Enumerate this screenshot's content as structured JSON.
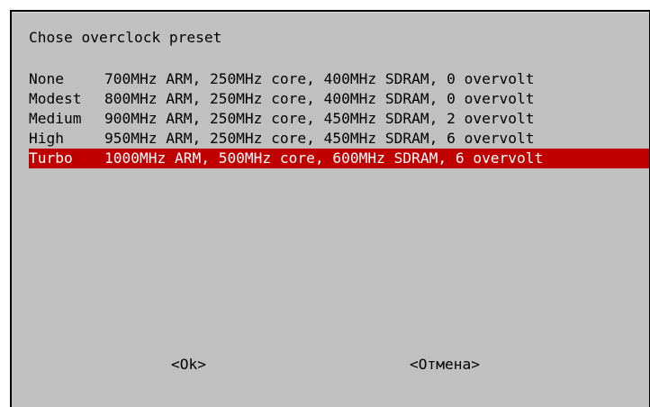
{
  "dialog": {
    "title": "Chose overclock preset",
    "items": [
      {
        "name": "None",
        "description": "700MHz ARM, 250MHz core, 400MHz SDRAM, 0 overvolt",
        "selected": false
      },
      {
        "name": "Modest",
        "description": "800MHz ARM, 250MHz core, 400MHz SDRAM, 0 overvolt",
        "selected": false
      },
      {
        "name": "Medium",
        "description": "900MHz ARM, 250MHz core, 450MHz SDRAM, 2 overvolt",
        "selected": false
      },
      {
        "name": "High",
        "description": "950MHz ARM, 250MHz core, 450MHz SDRAM, 6 overvolt",
        "selected": false
      },
      {
        "name": "Turbo",
        "description": "1000MHz ARM, 500MHz core, 600MHz SDRAM, 6 overvolt",
        "selected": true
      }
    ],
    "buttons": {
      "ok_label": "<Ok>",
      "cancel_label": "<Отмена>"
    }
  },
  "colors": {
    "dialog_background": "#c0c0c0",
    "selection_background": "#c00000",
    "selection_text": "#ffffff",
    "text": "#000000",
    "frame": "#000000"
  }
}
